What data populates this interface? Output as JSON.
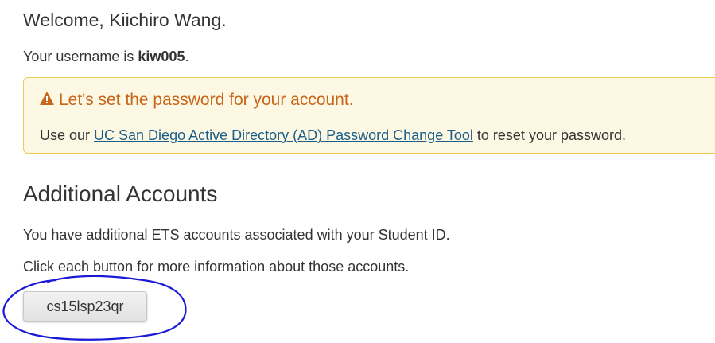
{
  "welcome": {
    "prefix": "Welcome, ",
    "name": "Kiichiro Wang",
    "suffix": "."
  },
  "username": {
    "prefix": "Your username is ",
    "value": "kiw005",
    "suffix": "."
  },
  "alert": {
    "icon": "warning-icon",
    "title": "Let's set the password for your account.",
    "body_prefix": "Use our ",
    "link_text": "UC San Diego Active Directory (AD) Password Change Tool",
    "body_suffix": " to reset your password.",
    "title_color": "#c7651a",
    "background": "#fcf8e3"
  },
  "additional_accounts": {
    "heading": "Additional Accounts",
    "description": "You have additional ETS accounts associated with your Student ID.",
    "instruction": "Click each button for more information about those accounts.",
    "accounts": [
      "cs15lsp23qr"
    ]
  },
  "annotation": {
    "type": "hand-drawn circle",
    "color": "#1a1ad6"
  }
}
